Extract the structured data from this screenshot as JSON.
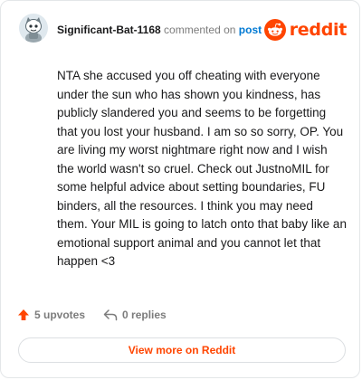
{
  "comment": {
    "username": "Significant-Bat-1168",
    "action_text": "commented on",
    "post_link_label": "post",
    "body": "NTA she accused you off cheating with everyone under the sun who has shown you kindness, has publicly slandered you and seems to be forgetting that you lost your husband. I am so so sorry, OP. You are living my worst nightmare right now and I wish the world wasn't so cruel. Check out JustnoMIL for some helpful advice about setting boundaries, FU binders, all the resources. I think you may need them. Your MIL is going to latch onto that baby like an emotional support animal and you cannot let that happen <3"
  },
  "brand": {
    "wordmark": "reddit",
    "icon": "reddit-logo-icon",
    "color": "#ff4500"
  },
  "footer": {
    "upvotes_label": "5 upvotes",
    "upvote_icon": "upvote-arrow-icon",
    "replies_label": "0 replies",
    "reply_icon": "reply-arrow-icon"
  },
  "cta": {
    "label": "View more on Reddit"
  },
  "colors": {
    "accent": "#ff4500",
    "link": "#0079d3",
    "text": "#1a1a1b",
    "muted": "#7c7c7c"
  }
}
